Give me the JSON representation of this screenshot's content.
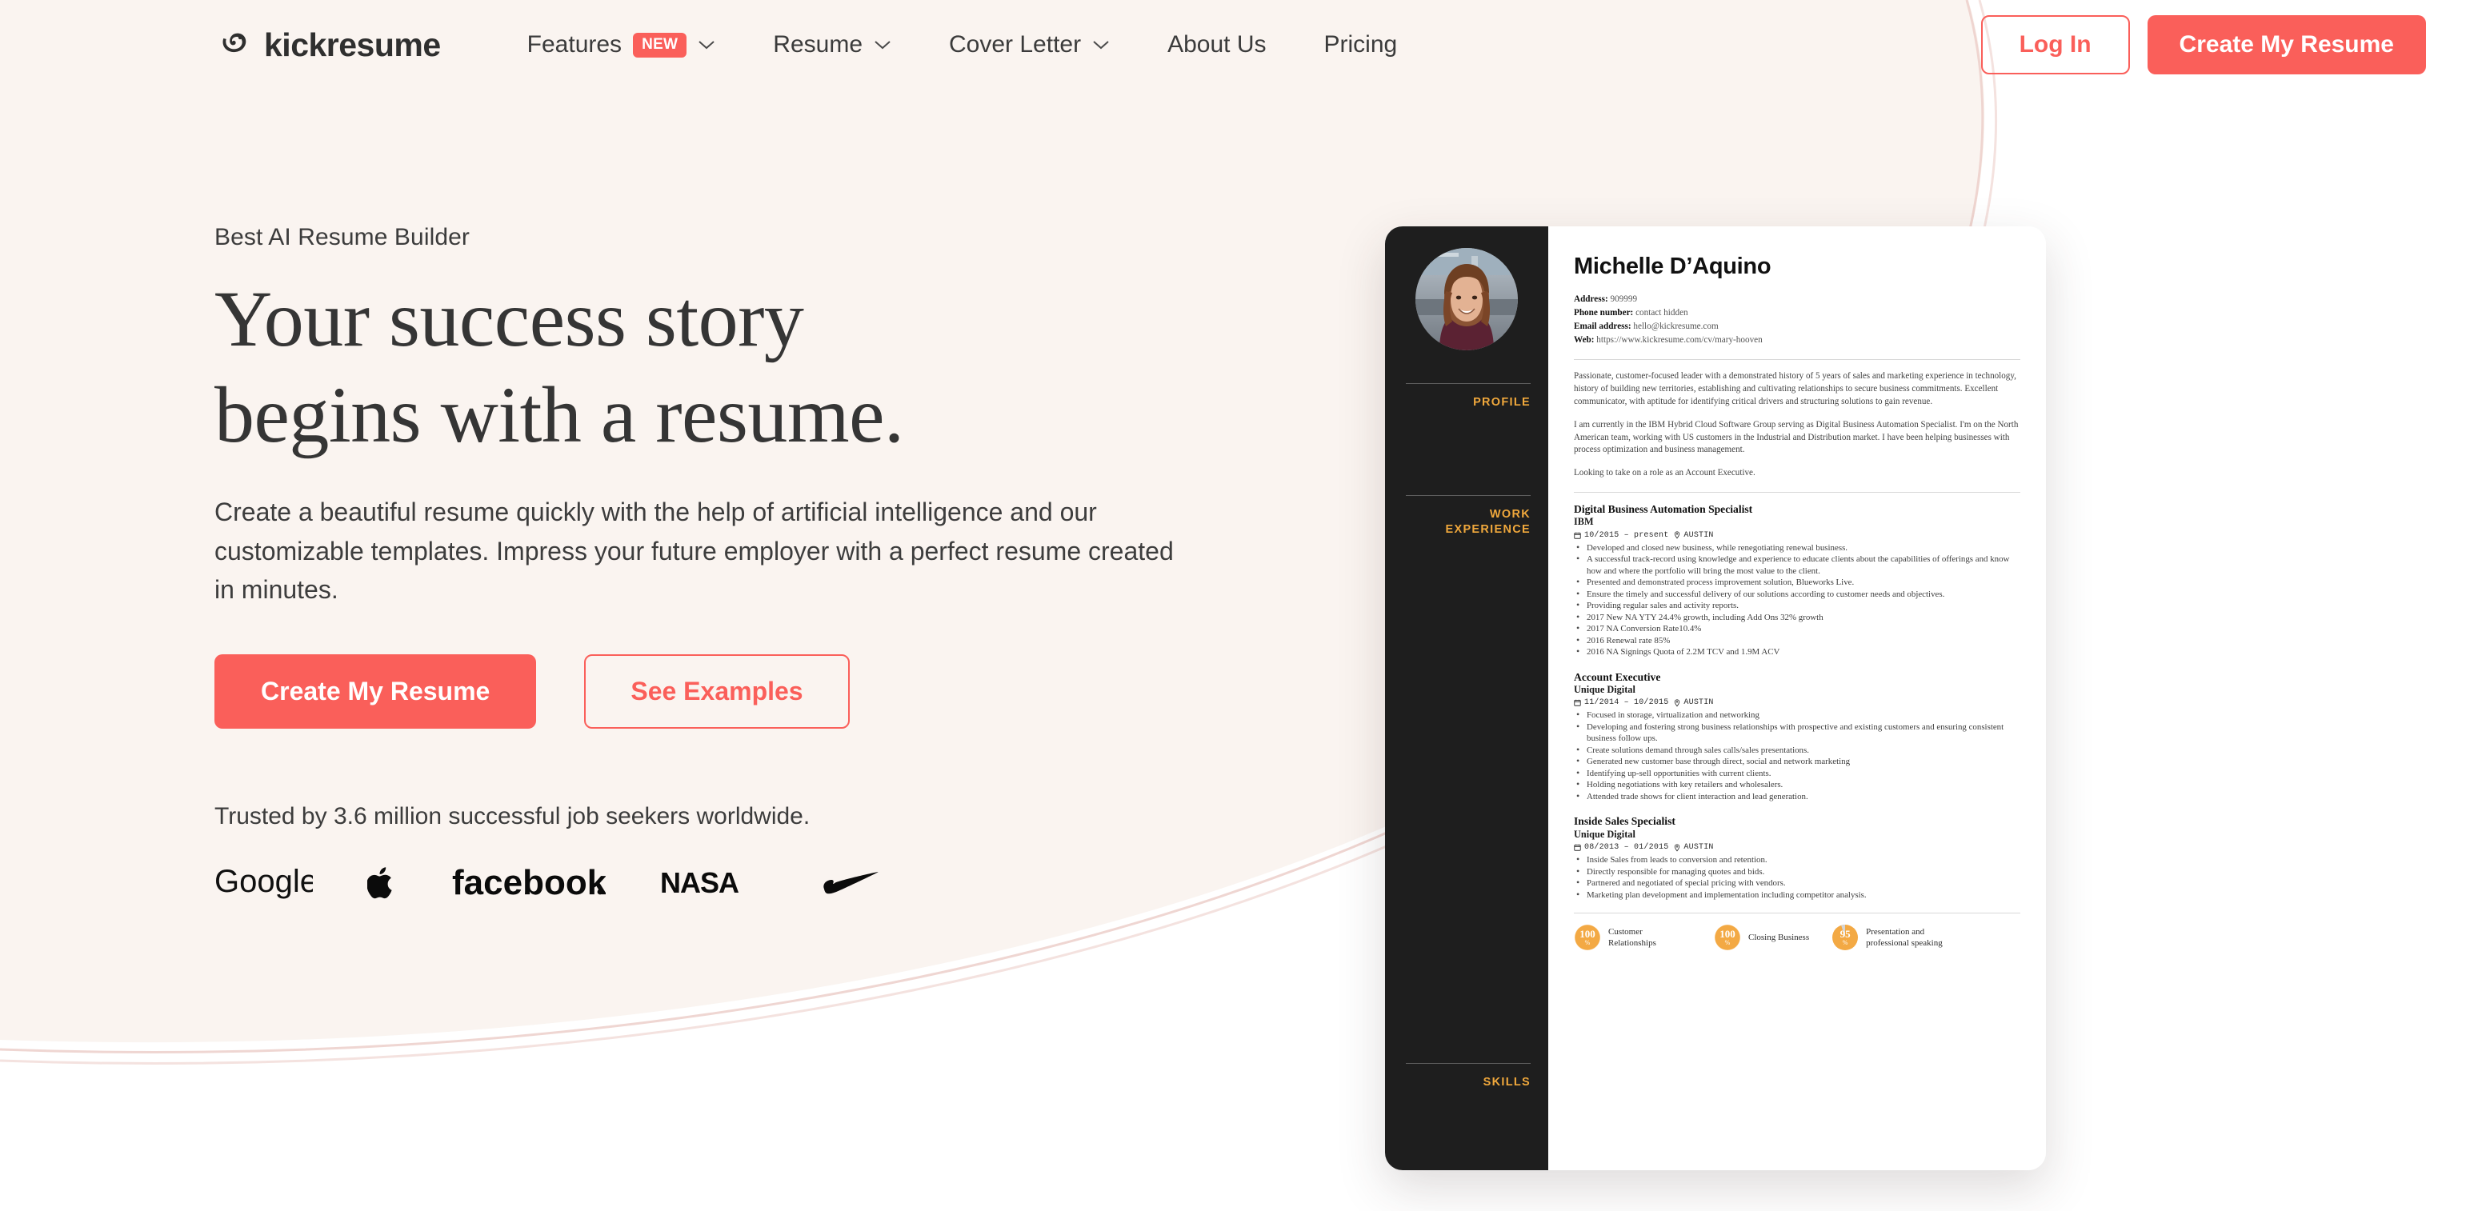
{
  "colors": {
    "accent": "#fa5f5a",
    "page_bg": "#faf4f0",
    "white": "#ffffff",
    "resume_sidebar": "#1e1e1e",
    "resume_label": "#f0a83c",
    "skill_dial": "#f3a944"
  },
  "nav": {
    "brand": "kickresume",
    "brand_icon": "kickresume-logo-icon",
    "items": [
      {
        "label": "Features",
        "badge": "NEW",
        "has_chevron": true
      },
      {
        "label": "Resume",
        "badge": "",
        "has_chevron": true
      },
      {
        "label": "Cover Letter",
        "badge": "",
        "has_chevron": true
      },
      {
        "label": "About Us",
        "badge": "",
        "has_chevron": false
      },
      {
        "label": "Pricing",
        "badge": "",
        "has_chevron": false
      }
    ],
    "login_label": "Log In",
    "create_label": "Create My Resume"
  },
  "hero": {
    "eyebrow": "Best AI Resume Builder",
    "headline_line1": "Your success story",
    "headline_line2": "begins with a resume.",
    "subcopy": "Create a beautiful resume quickly with the help of artificial intelligence and our customizable templates. Impress your future employer with a perfect resume created in minutes.",
    "primary_cta": "Create My Resume",
    "secondary_cta": "See Examples",
    "trusted_text": "Trusted by 3.6 million successful job seekers worldwide.",
    "logos": [
      "Google",
      "Apple",
      "facebook",
      "NASA",
      "Nike"
    ]
  },
  "resume": {
    "sidebar_labels": {
      "profile": "PROFILE",
      "work_experience": "WORK\nEXPERIENCE",
      "work_experience_line1": "WORK",
      "work_experience_line2": "EXPERIENCE",
      "skills": "SKILLS"
    },
    "photo_alt": "profile-photo",
    "name": "Michelle D’Aquino",
    "contact": [
      {
        "label": "Address:",
        "value": "909999"
      },
      {
        "label": "Phone number:",
        "value": "contact hidden"
      },
      {
        "label": "Email address:",
        "value": "hello@kickresume.com"
      },
      {
        "label": "Web:",
        "value": "https://www.kickresume.com/cv/mary-hooven"
      }
    ],
    "profile_paragraphs": [
      "Passionate, customer-focused leader with a demonstrated history of 5 years of sales and marketing experience in technology, history of building new territories, establishing and cultivating relationships to secure business commitments. Excellent communicator, with aptitude for identifying critical drivers and structuring solutions to gain revenue.",
      "I am currently in the IBM Hybrid Cloud Software Group serving as Digital Business Automation Specialist. I'm on the North American team, working with US customers in the Industrial and Distribution market. I have been helping businesses with process optimization and business management.",
      "Looking to take on a role as an Account Executive."
    ],
    "jobs": [
      {
        "title": "Digital Business Automation Specialist",
        "company": "IBM",
        "dates": "10/2015 – present",
        "location": "AUSTIN",
        "bullets": [
          "Developed and closed new business, while renegotiating renewal business.",
          "A successful track-record using knowledge and experience  to educate clients about the capabilities of offerings and know how and where the portfolio will bring the most value to the client.",
          "Presented and demonstrated process improvement solution, Blueworks Live.",
          "Ensure the timely and successful delivery of our solutions according to customer needs and objectives.",
          "Providing regular sales and activity reports.",
          "2017 New NA YTY 24.4% growth, including Add Ons 32% growth",
          "2017 NA Conversion Rate10.4%",
          "2016 Renewal rate 85%",
          "2016 NA Signings Quota of 2.2M TCV and 1.9M ACV"
        ]
      },
      {
        "title": "Account Executive",
        "company": "Unique Digital",
        "dates": "11/2014 – 10/2015",
        "location": "AUSTIN",
        "bullets": [
          "Focused in storage, virtualization and networking",
          "Developing and fostering strong business relationships with prospective and existing customers and ensuring consistent business follow ups.",
          "Create solutions demand through sales calls/sales presentations.",
          "Generated new customer base through direct, social and network marketing",
          "Identifying up-sell opportunities with current clients.",
          "Holding negotiations with key retailers and wholesalers.",
          "Attended trade shows for client interaction and lead generation."
        ]
      },
      {
        "title": "Inside Sales Specialist",
        "company": "Unique Digital",
        "dates": "08/2013 – 01/2015",
        "location": "AUSTIN",
        "bullets": [
          "Inside Sales from leads to conversion and retention.",
          "Directly responsible for managing quotes and bids.",
          "Partnered and negotiated of special pricing with vendors.",
          "Marketing plan development and implementation including competitor analysis."
        ]
      }
    ],
    "skills": [
      {
        "value": "100",
        "unit": "%",
        "name": "Customer Relationships",
        "percent": 100
      },
      {
        "value": "100",
        "unit": "%",
        "name": "Closing Business",
        "percent": 100
      },
      {
        "value": "95",
        "unit": "%",
        "name": "Presentation and professional speaking",
        "percent": 95
      }
    ]
  }
}
